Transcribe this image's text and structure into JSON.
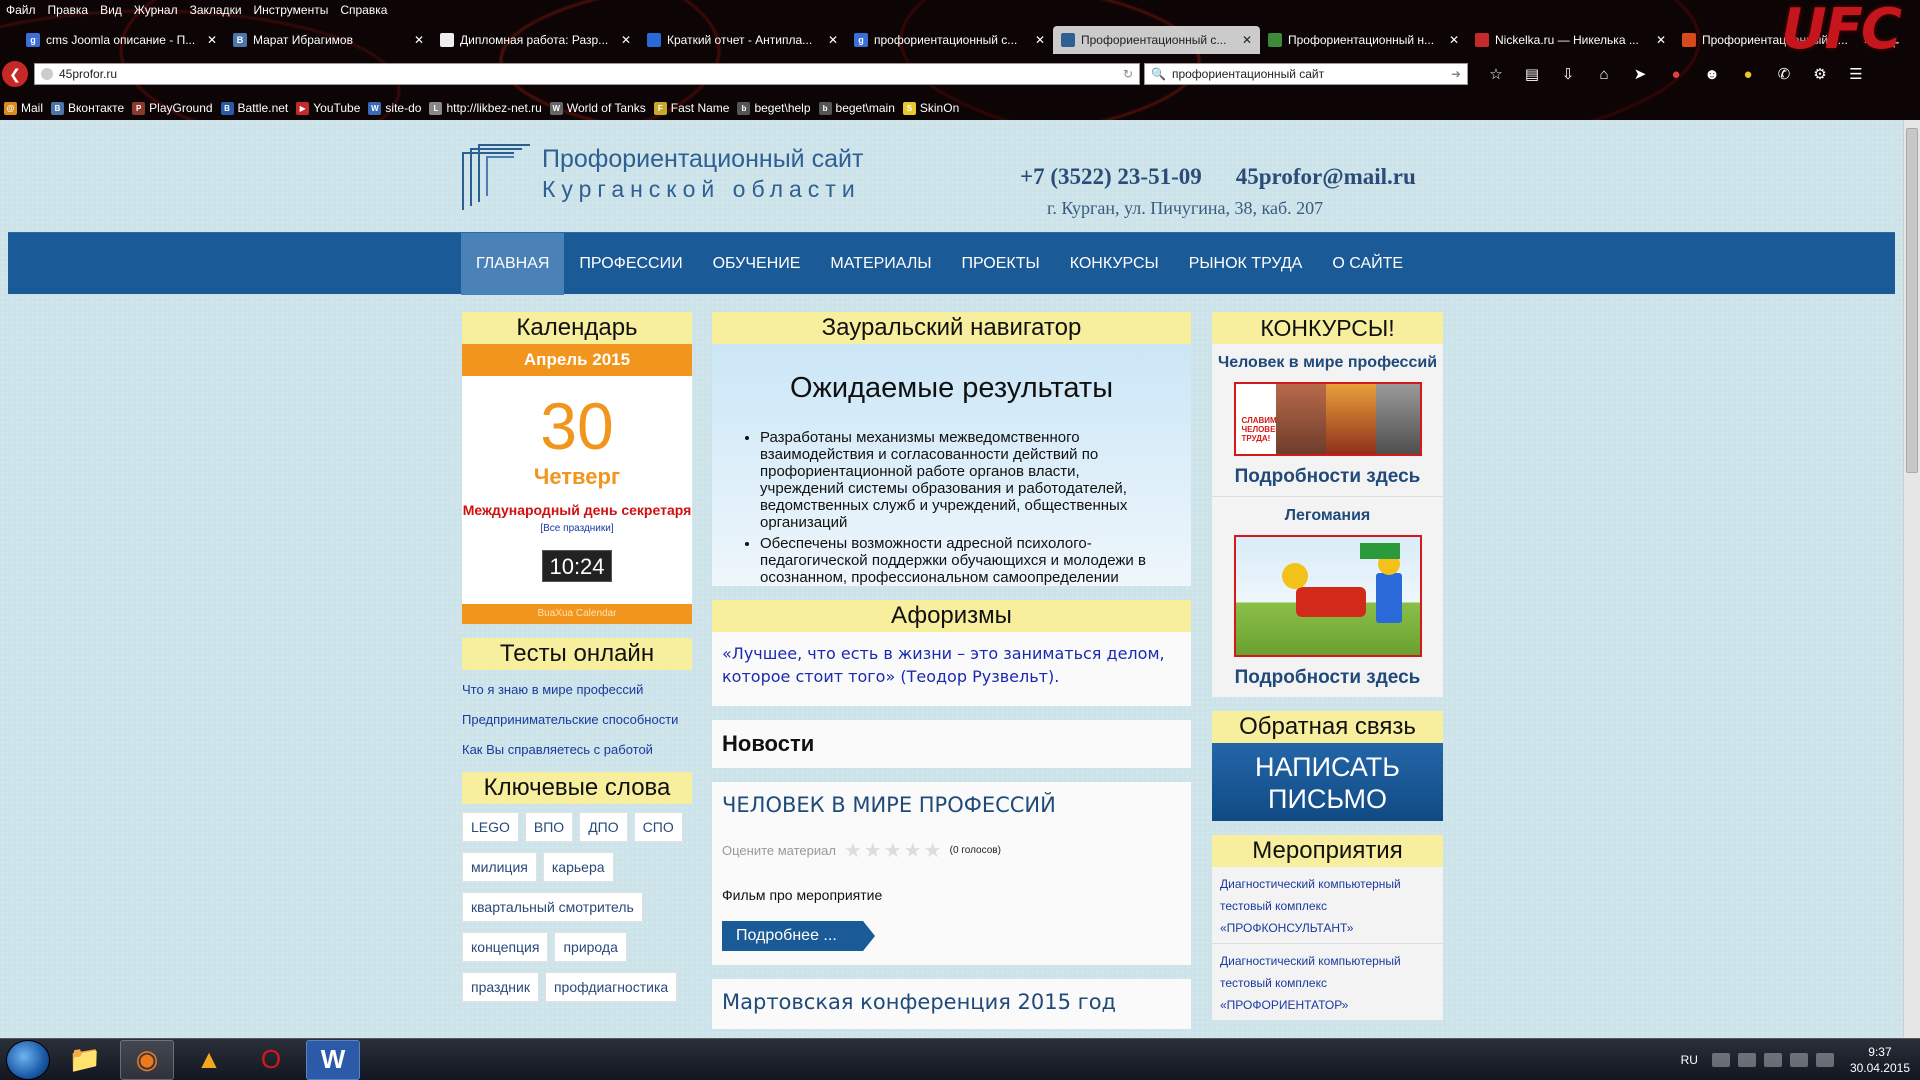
{
  "browser": {
    "menu": [
      "Файл",
      "Правка",
      "Вид",
      "Журнал",
      "Закладки",
      "Инструменты",
      "Справка"
    ],
    "tabs": [
      {
        "title": "cms Joomla описание - П...",
        "fav": "g",
        "color": "#3b6fd8",
        "active": false
      },
      {
        "title": "Марат Ибрагимов",
        "fav": "B",
        "color": "#4a76a8",
        "active": false
      },
      {
        "title": "Дипломная работа: Разр...",
        "fav": "",
        "color": "#eee",
        "active": false
      },
      {
        "title": "Краткий отчет - Антипла...",
        "fav": "",
        "color": "#2a6ad8",
        "active": false
      },
      {
        "title": "профориентационный с...",
        "fav": "g",
        "color": "#3b6fd8",
        "active": false
      },
      {
        "title": "Профориентационный с...",
        "fav": "",
        "color": "#2f5f93",
        "active": true
      },
      {
        "title": "Профориентационный н...",
        "fav": "",
        "color": "#3a8a3a",
        "active": false
      },
      {
        "title": "Nickelka.ru — Никелька ...",
        "fav": "",
        "color": "#c42a2a",
        "active": false
      },
      {
        "title": "Профориентационный в...",
        "fav": "",
        "color": "#d84a1a",
        "active": false
      }
    ],
    "new_tab": "+",
    "url": "45profor.ru",
    "search": "профориентационный сайт",
    "bookmarks": [
      {
        "label": "Mail",
        "color": "#d88a1a",
        "glyph": "@"
      },
      {
        "label": "Вконтакте",
        "color": "#4a76a8",
        "glyph": "B"
      },
      {
        "label": "PlayGround",
        "color": "#8a3a2a",
        "glyph": "P"
      },
      {
        "label": "Battle.net",
        "color": "#2a5aa8",
        "glyph": "B"
      },
      {
        "label": "YouTube",
        "color": "#c42a2a",
        "glyph": "▶"
      },
      {
        "label": "site-do",
        "color": "#3a6ab8",
        "glyph": "W"
      },
      {
        "label": "http://likbez-net.ru",
        "color": "#888",
        "glyph": "L"
      },
      {
        "label": "World of Tanks",
        "color": "#666",
        "glyph": "W"
      },
      {
        "label": "Fast Name",
        "color": "#c8a82a",
        "glyph": "F"
      },
      {
        "label": "beget\\help",
        "color": "#555",
        "glyph": "b"
      },
      {
        "label": "beget\\main",
        "color": "#555",
        "glyph": "b"
      },
      {
        "label": "SkinOn",
        "color": "#e8c82a",
        "glyph": "S"
      }
    ]
  },
  "site": {
    "logo_line1": "Профориентационный сайт",
    "logo_line2": "Курганской области",
    "phone": "+7 (3522) 23-51-09",
    "email": "45profor@mail.ru",
    "address": "г. Курган, ул. Пичугина, 38, каб. 207",
    "nav": [
      "Главная",
      "Профессии",
      "Обучение",
      "Материалы",
      "Проекты",
      "Конкурсы",
      "Рынок труда",
      "О сайте"
    ],
    "nav_active": 0
  },
  "calendar": {
    "title": "Календарь",
    "month": "Апрель 2015",
    "day": "30",
    "weekday": "Четверг",
    "holiday": "Международный день секретаря",
    "all_holidays": "[Все праздники]",
    "clock": "10:24",
    "footer": "BuaXua Calendar"
  },
  "tests": {
    "title": "Тесты онлайн",
    "links": [
      "Что я знаю в мире профессий",
      "Предпринимательские способности",
      "Как Вы справляетесь с работой"
    ]
  },
  "tags": {
    "title": "Ключевые слова",
    "items": [
      "LEGO",
      "ВПО",
      "ДПО",
      "СПО",
      "милиция",
      "карьера",
      "квартальный смотритель",
      "концепция",
      "природа",
      "праздник",
      "профдиагностика"
    ]
  },
  "navigator": {
    "title": "Зауральский навигатор",
    "heading": "Ожидаемые результаты",
    "bullets": [
      "Разработаны механизмы межведомственного взаимодействия  и согласованности действий по профориентационной работе органов власти, учреждений системы образования и работодателей, ведомственных служб и учреждений, общественных организаций",
      "Обеспечены возможности адресной психолого-педагогической поддержки обучающихся и молодежи в осознанном, профессиональном самоопределении"
    ]
  },
  "aphorisms": {
    "title": "Афоризмы",
    "text": "«Лучшее, что есть в жизни – это заниматься делом, которое стоит того» (Теодор Рузвельт)."
  },
  "news": {
    "title": "Новости",
    "articles": [
      {
        "title": "ЧЕЛОВЕК В МИРЕ ПРОФЕССИЙ",
        "rate_label": "Оцените материал",
        "votes": "(0 голосов)",
        "intro": "Фильм про мероприятие",
        "more": "Подробнее ..."
      },
      {
        "title": "Мартовская конференция 2015 год"
      }
    ]
  },
  "contests": {
    "title": "КОНКУРСЫ!",
    "items": [
      {
        "name": "Человек в мире профессий",
        "more": "Подробности здесь",
        "badge": "СЛАВИМ ЧЕЛОВЕКА ТРУДА!"
      },
      {
        "name": "Легомания",
        "more": "Подробности здесь"
      }
    ]
  },
  "feedback": {
    "title": "Обратная связь",
    "button": "НАПИСАТЬ ПИСЬМО"
  },
  "events": {
    "title": "Мероприятия",
    "items": [
      "Диагностический компьютерный тестовый комплекс «ПРОФКОНСУЛЬТАНТ»",
      "Диагностический компьютерный тестовый комплекс «ПРОФОРИЕНТАТОР»"
    ]
  },
  "taskbar": {
    "lang": "RU",
    "time": "9:37",
    "date": "30.04.2015"
  }
}
